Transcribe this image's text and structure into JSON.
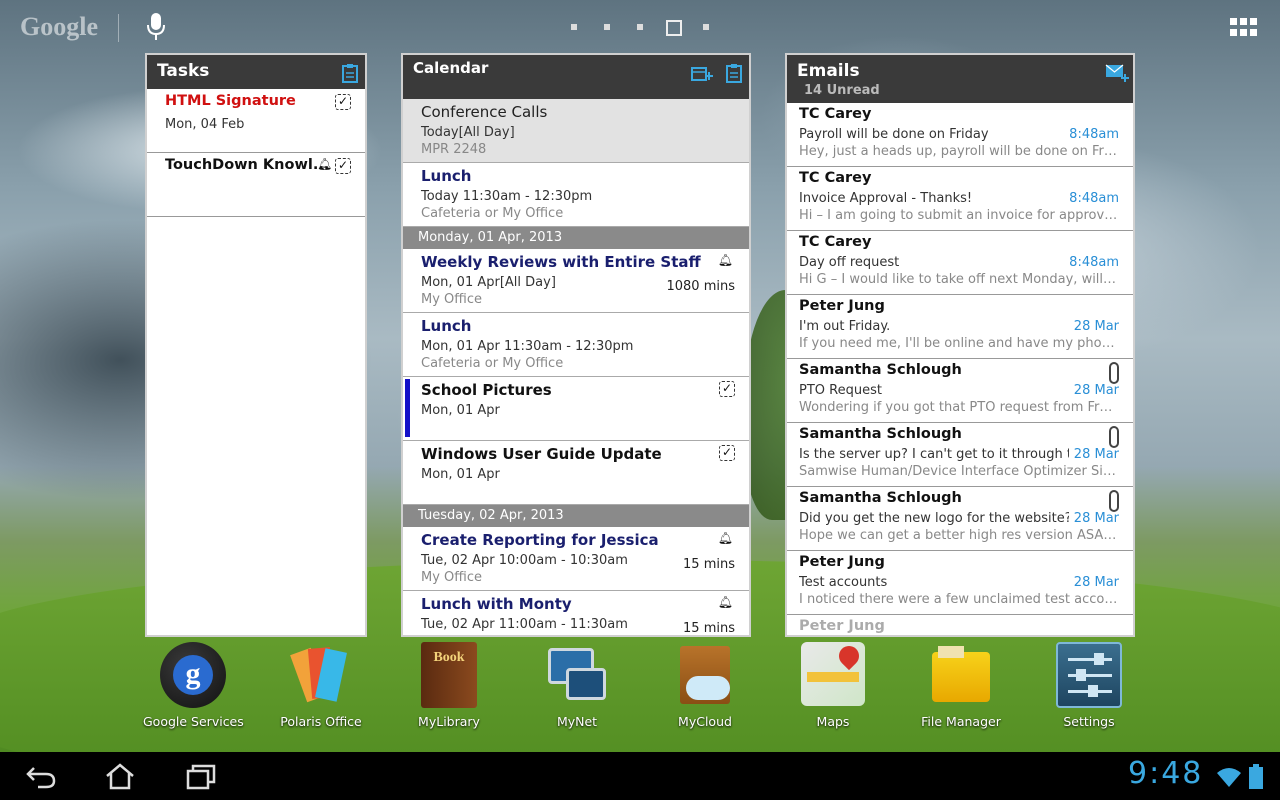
{
  "top_bar": {
    "search_label": "Google"
  },
  "tasks": {
    "title": "Tasks",
    "items": [
      {
        "name": "HTML Signature",
        "date": "Mon, 04 Feb"
      },
      {
        "name": "TouchDown Knowl...",
        "date": ""
      }
    ]
  },
  "calendar": {
    "title": "Calendar",
    "events": [
      {
        "name": "Conference Calls",
        "when": "Today[All Day]",
        "where": "MPR 2248"
      },
      {
        "name": "Lunch",
        "when": "Today 11:30am - 12:30pm",
        "where": "Cafeteria or My Office"
      }
    ],
    "day1": "Monday, 01 Apr, 2013",
    "day1_events": [
      {
        "name": "Weekly Reviews with Entire Staff",
        "when": "Mon, 01 Apr[All Day]",
        "where": "My Office",
        "duration": "1080 mins"
      },
      {
        "name": "Lunch",
        "when": "Mon, 01 Apr 11:30am - 12:30pm",
        "where": "Cafeteria or My Office"
      },
      {
        "name": "School Pictures",
        "when": "Mon, 01 Apr"
      },
      {
        "name": "Windows User Guide Update",
        "when": "Mon, 01 Apr"
      }
    ],
    "day2": "Tuesday, 02 Apr, 2013",
    "day2_events": [
      {
        "name": "Create Reporting for Jessica",
        "when": "Tue, 02 Apr 10:00am - 10:30am",
        "where": "My Office",
        "duration": "15 mins"
      },
      {
        "name": "Lunch with Monty",
        "when": "Tue, 02 Apr 11:00am - 11:30am",
        "duration": "15 mins"
      }
    ]
  },
  "emails": {
    "title": "Emails",
    "unread": "14 Unread",
    "items": [
      {
        "from": "TC Carey",
        "subject": "Payroll will be done on Friday",
        "time": "8:48am",
        "preview": "Hey, just a heads up, payroll will be done on Frida..."
      },
      {
        "from": "TC Carey",
        "subject": "Invoice Approval - Thanks!",
        "time": "8:48am",
        "preview": "Hi – I am going to submit an invoice for approval t..."
      },
      {
        "from": "TC Carey",
        "subject": "Day off request",
        "time": "8:48am",
        "preview": "Hi G – I would like to take off next Monday, will tha..."
      },
      {
        "from": "Peter Jung",
        "subject": "I'm out Friday.",
        "time": "28 Mar",
        "preview": "If you need me, I'll be online and have my phone o..."
      },
      {
        "from": "Samantha Schlough",
        "subject": "PTO Request",
        "time": "28 Mar",
        "preview": "Wondering if you got that PTO request from Franci..."
      },
      {
        "from": "Samantha Schlough",
        "subject": "Is the server up? I can't get to it through the...",
        "time": "28 Mar",
        "preview": "Samwise Human/Device Interface Optimizer Site:..."
      },
      {
        "from": "Samantha Schlough",
        "subject": "Did you get the new logo for the website?",
        "time": "28 Mar",
        "preview": "Hope we can get a better high res version ASAP so..."
      },
      {
        "from": "Peter Jung",
        "subject": "Test accounts",
        "time": "28 Mar",
        "preview": "I noticed there were a few unclaimed test accounts..."
      },
      {
        "from": "Peter Jung",
        "subject": "",
        "time": "",
        "preview": ""
      }
    ]
  },
  "dock": [
    {
      "label": "Google Services",
      "icon": "google-services-icon"
    },
    {
      "label": "Polaris Office",
      "icon": "polaris-office-icon"
    },
    {
      "label": "MyLibrary",
      "icon": "mylibrary-icon"
    },
    {
      "label": "MyNet",
      "icon": "mynet-icon"
    },
    {
      "label": "MyCloud",
      "icon": "mycloud-icon"
    },
    {
      "label": "Maps",
      "icon": "maps-icon"
    },
    {
      "label": "File Manager",
      "icon": "file-manager-icon"
    },
    {
      "label": "Settings",
      "icon": "settings-icon"
    }
  ],
  "status": {
    "time": "9:48"
  },
  "colors": {
    "accent": "#2a8fd6",
    "task_overdue": "#d01010",
    "event_title": "#1a1f6e",
    "clock": "#3aa8e0"
  }
}
